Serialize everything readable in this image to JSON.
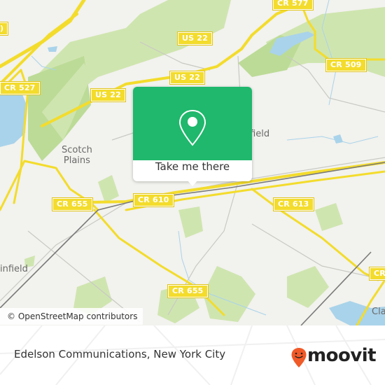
{
  "map": {
    "colors": {
      "background": "#f2f2ee",
      "park": "#cfe5b0",
      "park_dark": "#bcdb97",
      "water": "#a9d3ea",
      "highway": "#f3dc2c",
      "rail": "#7a7a7a",
      "minor_road": "#c9c9c4"
    },
    "road_shields": [
      {
        "id": "cr577",
        "label": "CR 577"
      },
      {
        "id": "us22a",
        "label": "US 22"
      },
      {
        "id": "cr509",
        "label": "CR 509"
      },
      {
        "id": "cr527",
        "label": "CR 527"
      },
      {
        "id": "us22b",
        "label": "US 22"
      },
      {
        "id": "us22c",
        "label": "US 22"
      },
      {
        "id": "cr655a",
        "label": "CR 655"
      },
      {
        "id": "cr610",
        "label": "CR 610"
      },
      {
        "id": "cr613",
        "label": "CR 613"
      },
      {
        "id": "cr655b",
        "label": "CR 655"
      },
      {
        "id": "cr_edge",
        "label": "CR"
      },
      {
        "id": "edge_left",
        "label": ")"
      }
    ],
    "places": [
      {
        "id": "scotch-plains",
        "label": "Scotch\nPlains"
      },
      {
        "id": "westfield",
        "label": "tfield"
      },
      {
        "id": "plainfield",
        "label": "infield"
      },
      {
        "id": "clark",
        "label": "Cla"
      }
    ]
  },
  "popup": {
    "accent": "#1fb86c",
    "icon": "location-pin-icon",
    "button_label": "Take me there"
  },
  "attribution": "© OpenStreetMap contributors",
  "footer": {
    "title": "Edelson Communications, New York City",
    "brand": "moovit",
    "brand_color": "#f05a28"
  }
}
